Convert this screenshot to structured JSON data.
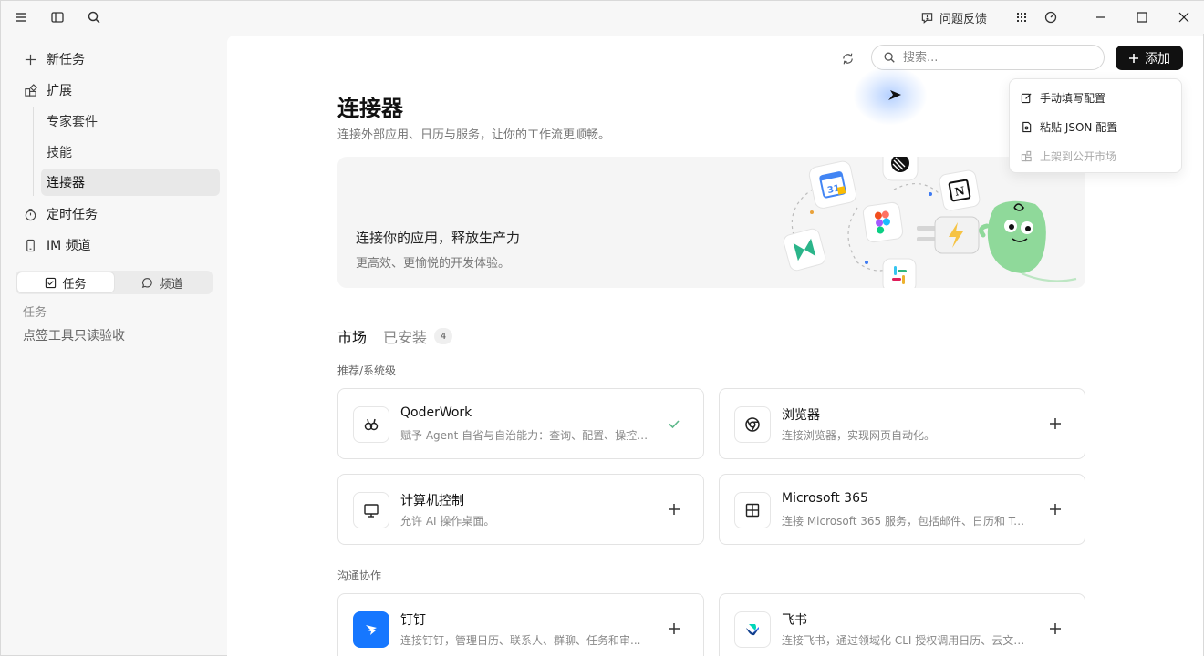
{
  "titlebar": {
    "feedback_label": "问题反馈"
  },
  "sidebar": {
    "new_task": "新任务",
    "extensions": "扩展",
    "sub_items": [
      "专家套件",
      "技能",
      "连接器"
    ],
    "scheduled": "定时任务",
    "im_channel": "IM 频道",
    "seg_tasks": "任务",
    "seg_channels": "频道",
    "section_label": "任务",
    "task_item": "点签工具只读验收"
  },
  "main": {
    "search_placeholder": "搜索...",
    "add_label": "添加",
    "title": "连接器",
    "subtitle": "连接外部应用、日历与服务，让你的工作流更顺畅。",
    "banner_title": "连接你的应用，释放生产力",
    "banner_sub": "更高效、更愉悦的开发体验。",
    "tab_market": "市场",
    "tab_installed": "已安装",
    "installed_count": "4",
    "section_recommended": "推荐/系统级",
    "section_comm": "沟通协作"
  },
  "cards": [
    {
      "name": "QoderWork",
      "desc": "赋予 Agent 自省与自治能力：查询、配置、操控 ...",
      "status": "installed"
    },
    {
      "name": "浏览器",
      "desc": "连接浏览器，实现网页自动化。",
      "status": "add"
    },
    {
      "name": "计算机控制",
      "desc": "允许 AI 操作桌面。",
      "status": "add"
    },
    {
      "name": "Microsoft 365",
      "desc": "连接 Microsoft 365 服务，包括邮件、日历和 Tea...",
      "status": "add"
    },
    {
      "name": "钉钉",
      "desc": "连接钉钉，管理日历、联系人、群聊、任务和审...",
      "status": "add"
    },
    {
      "name": "飞书",
      "desc": "连接飞书，通过领域化 CLI 授权调用日历、云文档...",
      "status": "add"
    }
  ],
  "dropdown": {
    "items": [
      "手动填写配置",
      "粘贴 JSON 配置",
      "上架到公开市场"
    ]
  },
  "colors": {
    "accent_dark": "#111111",
    "active_bg": "#e8e8e8",
    "installed_check": "#5cb88a",
    "dingtalk_blue": "#1677ff",
    "mascot_green": "#8fd99a"
  }
}
